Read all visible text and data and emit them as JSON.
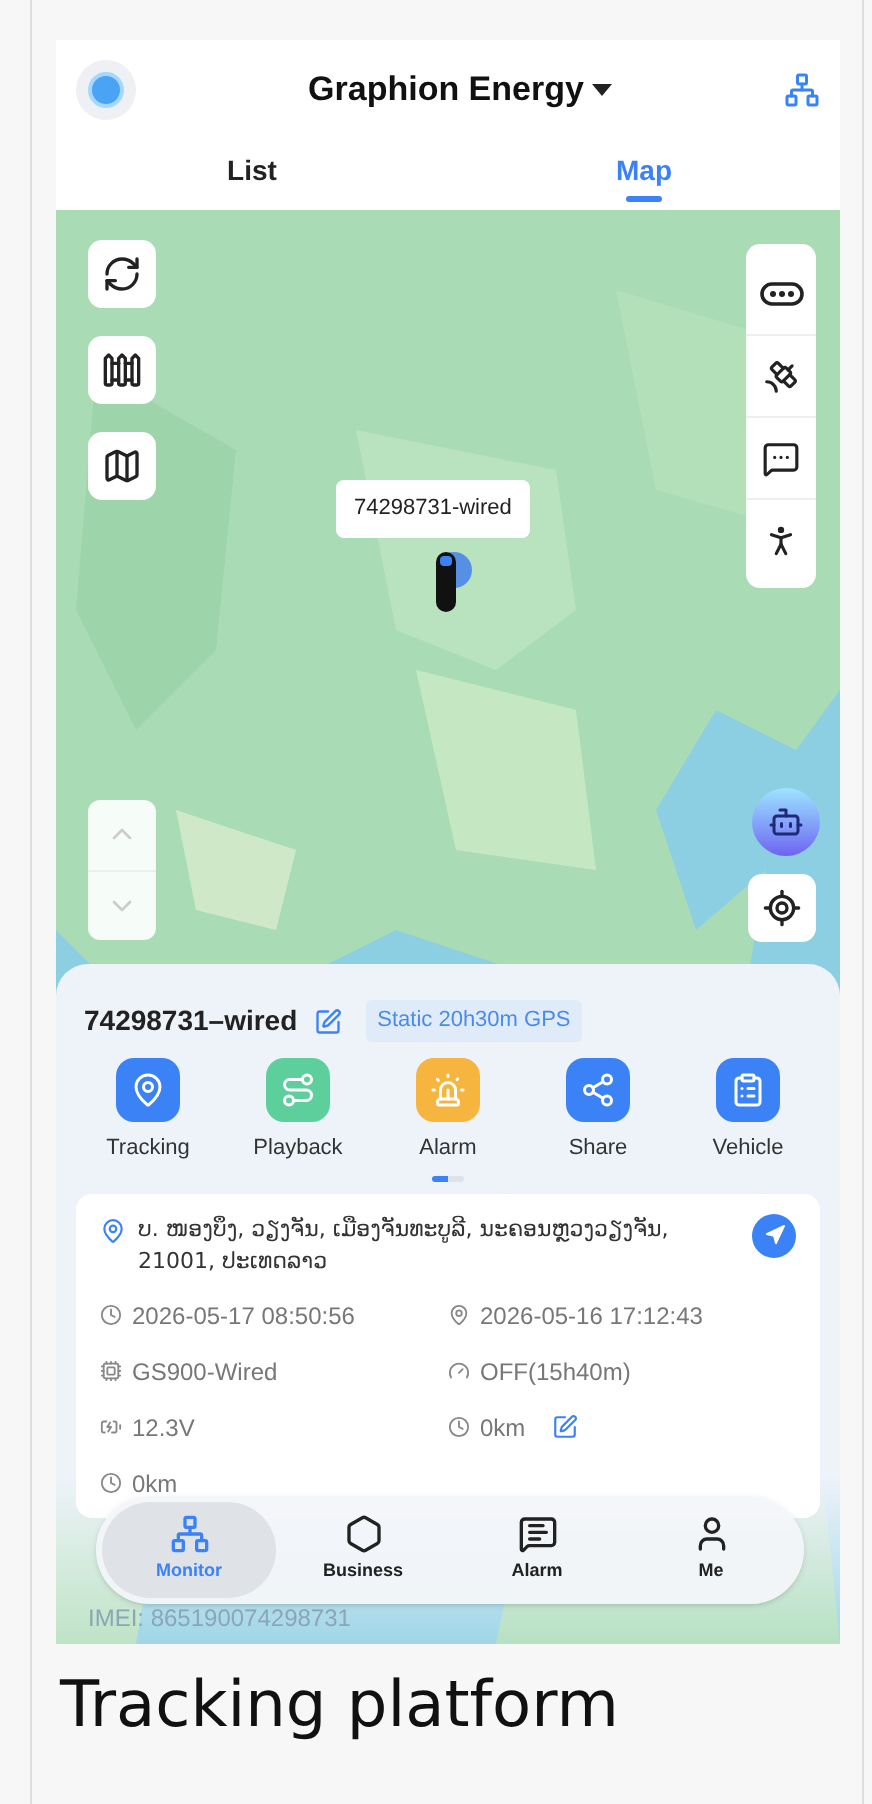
{
  "header": {
    "title": "Graphion Energy"
  },
  "tabs": [
    {
      "label": "List",
      "selected": false
    },
    {
      "label": "Map",
      "selected": true
    }
  ],
  "map": {
    "kind": "picture",
    "marker_label": "74298731-wired"
  },
  "device": {
    "name": "74298731–wired",
    "status": "Static 20h30m GPS"
  },
  "actions": [
    {
      "label": "Tracking",
      "color": "#3b82f6"
    },
    {
      "label": "Playback",
      "color": "#5ccf9c"
    },
    {
      "label": "Alarm",
      "color": "#f5b53e"
    },
    {
      "label": "Share",
      "color": "#3b82f6"
    },
    {
      "label": "Vehicle",
      "color": "#3b82f6"
    }
  ],
  "action_pages": [
    {
      "selected": true
    },
    {
      "selected": false
    }
  ],
  "info": {
    "address": "ບ. ໜອງບຶງ, ວຽງຈັນ, ເມືອງຈັນທະບູລີ, ນະຄອນຫຼວງວຽງຈັນ, 21001, ປະເທດລາວ",
    "fields": [
      {
        "text": "2026-05-17 08:50:56",
        "editable": false
      },
      {
        "text": "2026-05-16 17:12:43",
        "editable": false
      },
      {
        "text": "GS900-Wired",
        "editable": false
      },
      {
        "text": "OFF(15h40m)",
        "editable": false
      },
      {
        "text": "12.3V",
        "editable": false
      },
      {
        "text": "0km",
        "editable": true
      },
      {
        "text": "0km",
        "editable": false
      }
    ],
    "imei": "IMEI: 865190074298731"
  },
  "nav": [
    {
      "label": "Monitor",
      "selected": true
    },
    {
      "label": "Business",
      "selected": false
    },
    {
      "label": "Alarm",
      "selected": false
    },
    {
      "label": "Me",
      "selected": false
    }
  ],
  "caption": "Tracking platform"
}
